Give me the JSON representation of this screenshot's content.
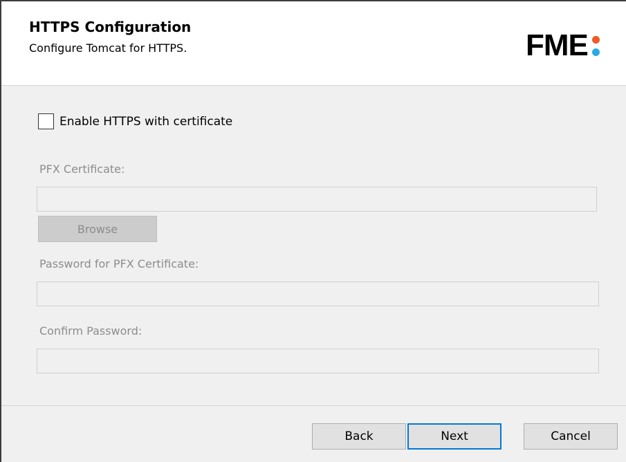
{
  "header": {
    "title": "HTTPS Configuration",
    "subtitle": "Configure Tomcat for HTTPS.",
    "logo": {
      "text": "FME",
      "dot_top_color": "#f15a24",
      "dot_bottom_color": "#29abe2"
    }
  },
  "form": {
    "enable_https": {
      "label": "Enable HTTPS with certificate",
      "checked": false
    },
    "pfx_certificate": {
      "label": "PFX Certificate:",
      "value": "",
      "enabled": false
    },
    "browse": {
      "label": "Browse",
      "enabled": false
    },
    "password": {
      "label": "Password for PFX Certificate:",
      "value": "",
      "enabled": false
    },
    "confirm_password": {
      "label": "Confirm Password:",
      "value": "",
      "enabled": false
    }
  },
  "footer": {
    "back_label": "Back",
    "next_label": "Next",
    "cancel_label": "Cancel"
  },
  "colors": {
    "accent": "#0078d7",
    "disabled_text": "#8c8c8c"
  }
}
